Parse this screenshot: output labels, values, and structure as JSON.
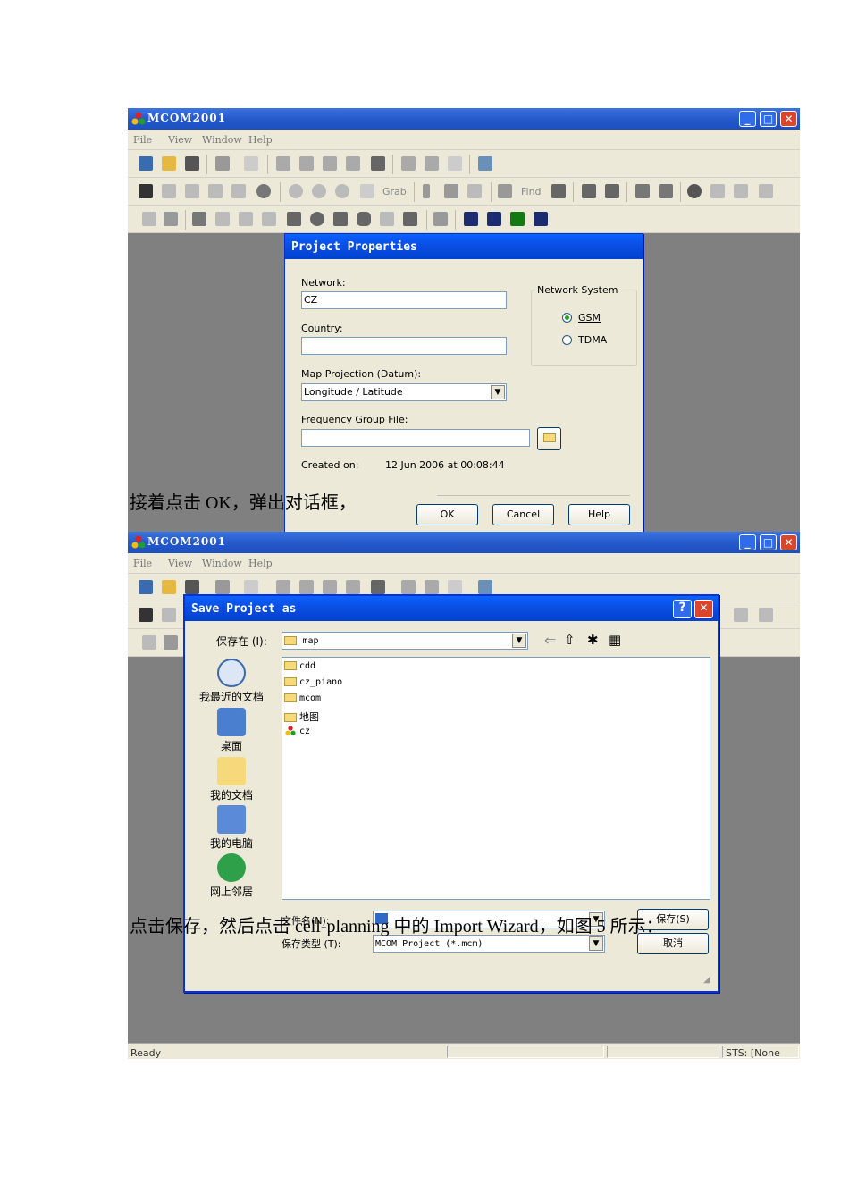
{
  "app": {
    "title": "MCOM2001",
    "menu": [
      "File",
      "View",
      "Window",
      "Help"
    ],
    "toolbar_labels": {
      "grab": "Grab",
      "find": "Find"
    },
    "status": {
      "ready": "Ready",
      "sts": "STS: [None"
    }
  },
  "project_dialog": {
    "title": "Project Properties",
    "network_label": "Network:",
    "network_value": "CZ",
    "country_label": "Country:",
    "country_value": "",
    "projection_label": "Map Projection (Datum):",
    "projection_value": "Longitude / Latitude",
    "freq_label": "Frequency Group File:",
    "freq_value": "",
    "created_label": "Created on:",
    "created_value": "12 Jun 2006 at 00:08:44",
    "network_system_label": "Network System",
    "radio_gsm": "GSM",
    "radio_tdma": "TDMA",
    "ok": "OK",
    "cancel": "Cancel",
    "help": "Help"
  },
  "save_dialog": {
    "title": "Save Project as",
    "save_in_label": "保存在 (I):",
    "save_in_value": "map",
    "places": [
      "我最近的文档",
      "桌面",
      "我的文档",
      "我的电脑",
      "网上邻居"
    ],
    "files": [
      "cdd",
      "cz_piano",
      "mcom",
      "地图",
      "cz"
    ],
    "filename_label": "文件名(N):",
    "filetype_label": "保存类型 (T):",
    "filetype_value": "MCOM Project (*.mcm)",
    "save_btn": "保存(S)",
    "cancel_btn": "取消"
  },
  "doc_text": {
    "line1": "接着点击 OK，弹出对话框，",
    "line2": "点击保存，然后点击 cell-planning 中的 Import Wizard，如图 5 所示："
  },
  "colors": {
    "titlebar": "#2457c9",
    "dialog_title": "#0a4de0",
    "workspace": "#808080"
  }
}
